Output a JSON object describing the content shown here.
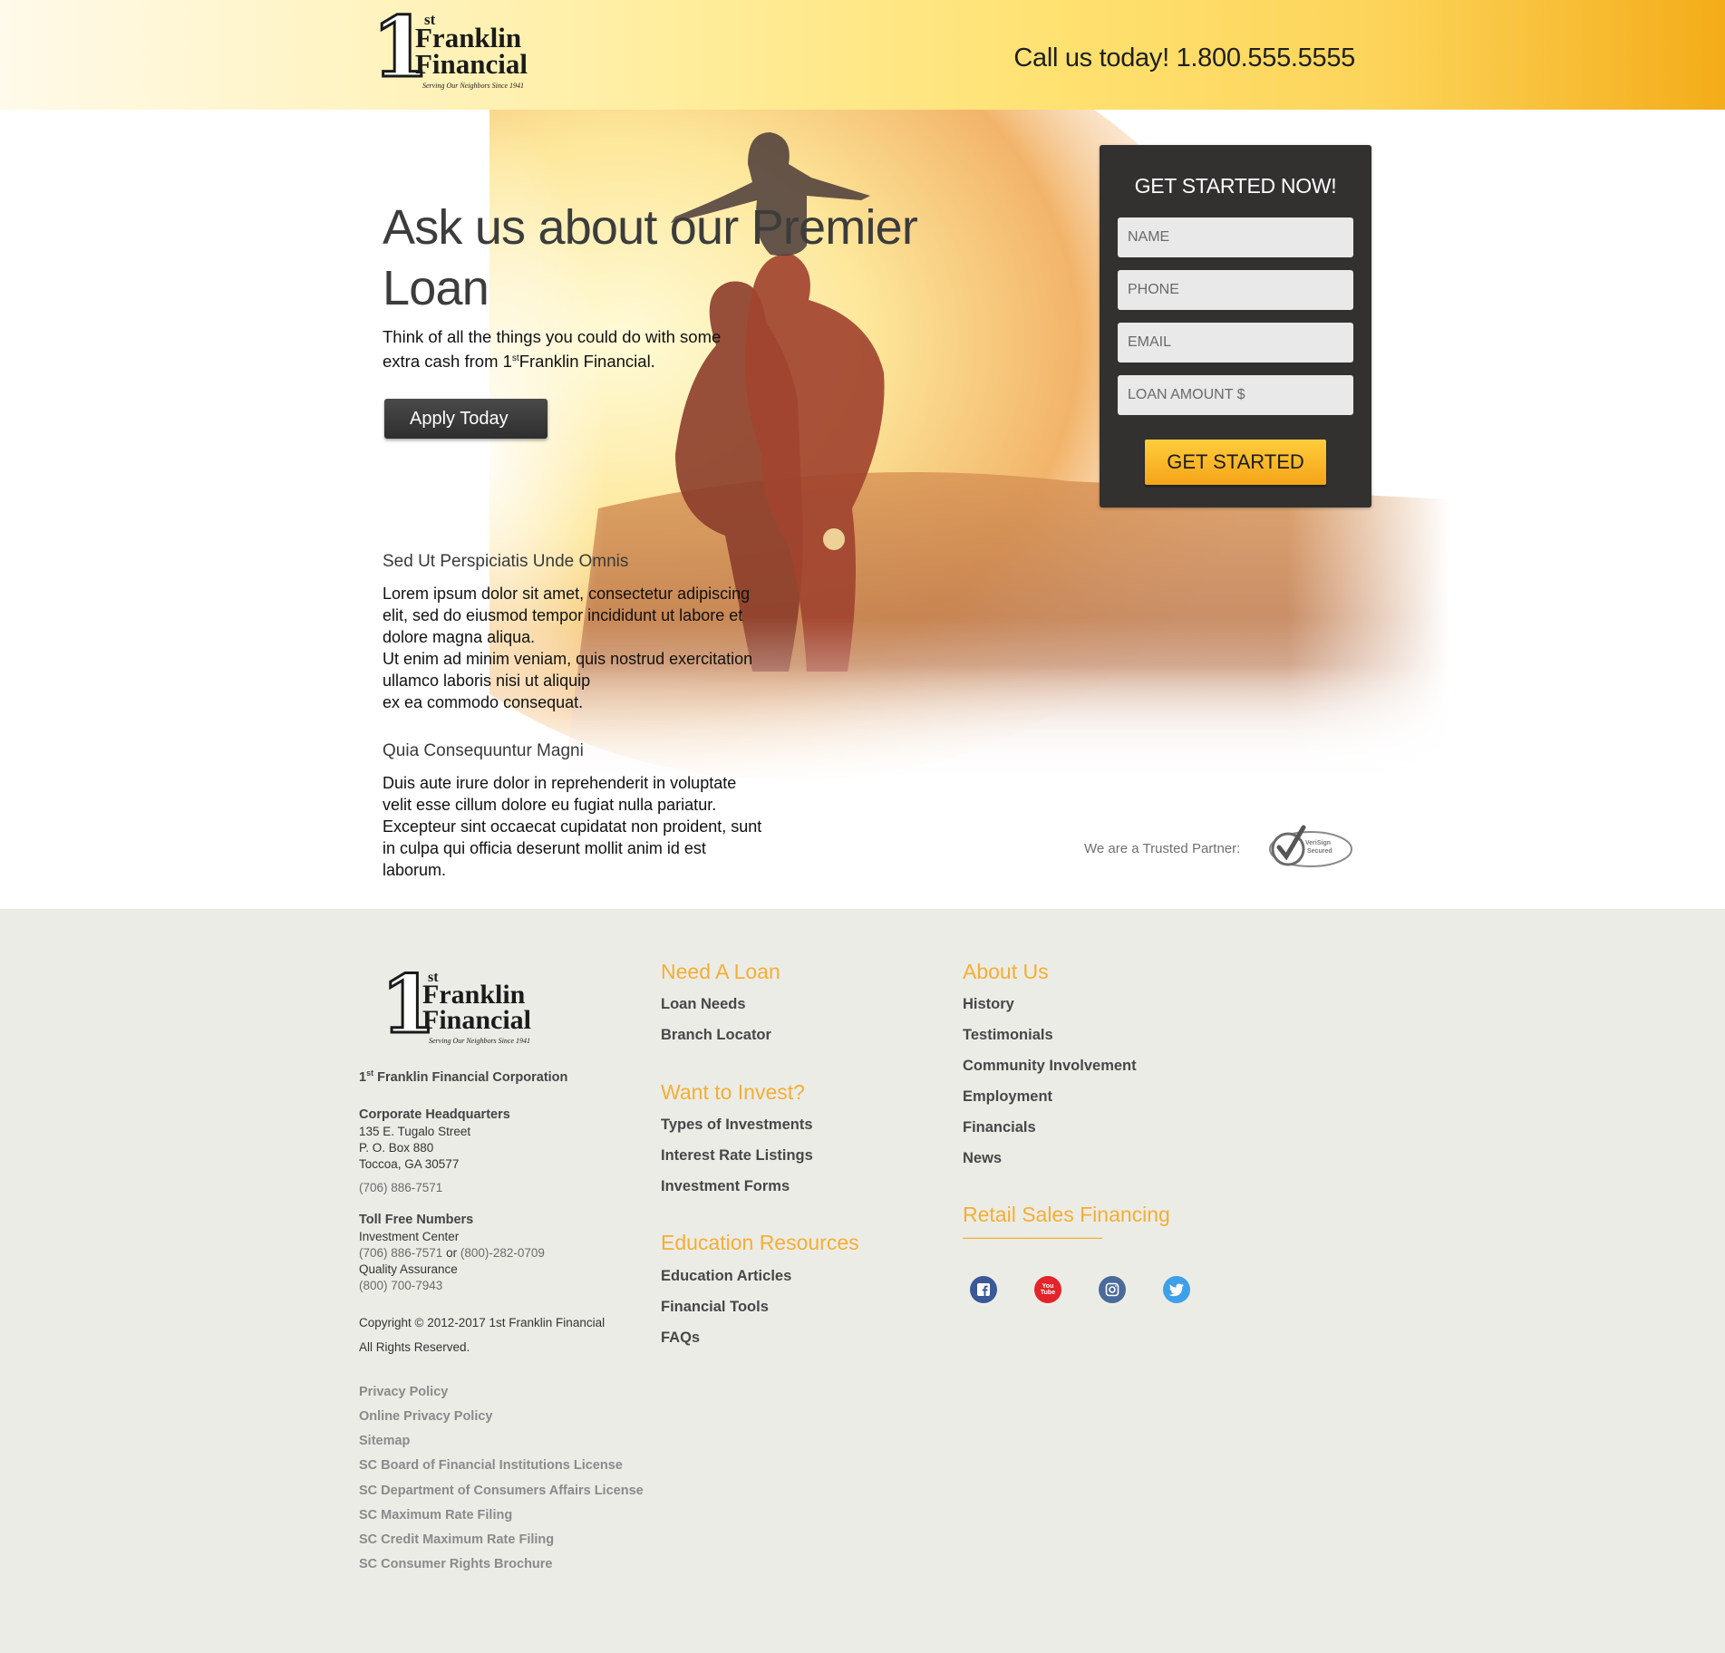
{
  "header": {
    "logo": {
      "numeral": "1",
      "superscript": "st",
      "line1": "Franklin",
      "line2": "Financial",
      "tagline": "Serving Our Neighbors Since 1941"
    },
    "call_text": "Call us today! 1.800.555.5555"
  },
  "hero": {
    "headline": "Ask us about our Premier Loan",
    "subhead_before": "Think of all the things you could do with some extra cash from 1",
    "subhead_sup": "st",
    "subhead_after": "Franklin Financial.",
    "apply_label": "Apply Today"
  },
  "sections": [
    {
      "heading": "Sed Ut Perspiciatis Unde Omnis",
      "lines": [
        "Lorem ipsum dolor sit amet, consectetur adipiscing",
        "elit, sed do eiusmod tempor incididunt ut labore et",
        "dolore magna aliqua.",
        "Ut enim ad minim veniam, quis nostrud exercitation",
        "ullamco laboris nisi ut aliquip",
        "ex ea commodo consequat."
      ]
    },
    {
      "heading": "Quia Consequuntur Magni",
      "lines": [
        "Duis aute irure dolor in reprehenderit in voluptate",
        "velit esse cillum dolore eu fugiat nulla pariatur.",
        "Excepteur sint occaecat cupidatat non proident, sunt",
        "in culpa qui officia deserunt mollit anim id est",
        "laborum."
      ]
    }
  ],
  "form": {
    "title": "GET STARTED NOW!",
    "fields": {
      "name": "NAME",
      "phone": "PHONE",
      "email": "EMAIL",
      "loan_amount": "LOAN AMOUNT $"
    },
    "submit_label": "GET STARTED"
  },
  "trust": {
    "label": "We are a Trusted Partner:",
    "badge_line1": "VeriSign",
    "badge_line2": "Secured"
  },
  "footer": {
    "corp_numeral": "1",
    "corp_sup": "st",
    "corp_name": "Franklin Financial Corporation",
    "hq_title": "Corporate Headquarters",
    "hq_address": [
      "135 E. Tugalo Street",
      "P. O. Box 880",
      "Toccoa, GA 30577"
    ],
    "hq_phone": "(706) 886-7571",
    "tollfree_title": "Toll Free Numbers",
    "investment_label": "Investment Center",
    "investment_phone1": "(706) 886-7571",
    "investment_or": "or",
    "investment_phone2": "(800)-282-0709",
    "qa_label": "Quality Assurance",
    "qa_phone": "(800) 700-7943",
    "copyright": "Copyright © 2012-2017 1st Franklin Financial",
    "rights": "All Rights Reserved.",
    "legal_links": [
      "Privacy Policy",
      "Online Privacy Policy",
      "Sitemap",
      "SC Board of Financial Institutions License",
      "SC Department of Consumers Affairs License",
      "SC Maximum Rate Filing",
      "SC Credit Maximum Rate Filing",
      "SC Consumer Rights Brochure"
    ],
    "columns": {
      "need_loan": {
        "title": "Need A Loan",
        "links": [
          "Loan Needs",
          "Branch Locator"
        ]
      },
      "invest": {
        "title": "Want to Invest?",
        "links": [
          "Types of Investments",
          "Interest Rate Listings",
          "Investment Forms"
        ]
      },
      "education": {
        "title": "Education Resources",
        "links": [
          "Education Articles",
          "Financial Tools",
          "FAQs"
        ]
      },
      "about": {
        "title": "About Us",
        "links": [
          "History",
          "Testimonials",
          "Community Involvement",
          "Employment",
          "Financials",
          "News"
        ]
      },
      "retail": {
        "title": "Retail Sales Financing",
        "underline": "—————————"
      }
    },
    "social": [
      {
        "name": "facebook-icon",
        "glyph": "f",
        "color": "#3b5998"
      },
      {
        "name": "youtube-icon",
        "glyph": "You Tube",
        "color": "#e3242b"
      },
      {
        "name": "instagram-icon",
        "glyph": "",
        "color": "#4a6a9a"
      },
      {
        "name": "twitter-icon",
        "glyph": "",
        "color": "#3da0e8"
      }
    ]
  },
  "colors": {
    "accent_orange": "#f5ae33",
    "form_bg": "#323130",
    "footer_bg": "#ecece7",
    "button_yellow": "#ffcd3c"
  }
}
